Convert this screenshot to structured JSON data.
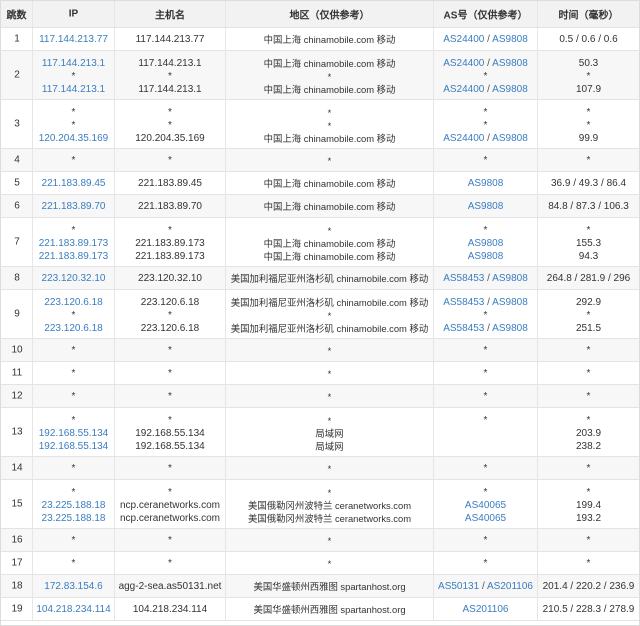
{
  "headers": [
    "跳数",
    "IP",
    "主机名",
    "地区（仅供参考）",
    "AS号（仅供参考）",
    "时间（毫秒）"
  ],
  "hops": [
    {
      "hop": "1",
      "lines": [
        {
          "ip": "117.144.213.77",
          "host": "117.144.213.77",
          "region": "中国上海 chinamobile.com 移动",
          "as": [
            "AS24400",
            "AS9808"
          ],
          "time": "0.5 / 0.6 / 0.6"
        }
      ]
    },
    {
      "hop": "2",
      "lines": [
        {
          "ip": "117.144.213.1",
          "host": "117.144.213.1",
          "region": "中国上海 chinamobile.com 移动",
          "as": [
            "AS24400",
            "AS9808"
          ],
          "time": "50.3"
        },
        {
          "ip": "*",
          "host": "*",
          "region": "*",
          "as": [
            "*"
          ],
          "time": "*"
        },
        {
          "ip": "117.144.213.1",
          "host": "117.144.213.1",
          "region": "中国上海 chinamobile.com 移动",
          "as": [
            "AS24400",
            "AS9808"
          ],
          "time": "107.9"
        }
      ]
    },
    {
      "hop": "3",
      "lines": [
        {
          "ip": "*",
          "host": "*",
          "region": "*",
          "as": [
            "*"
          ],
          "time": "*"
        },
        {
          "ip": "*",
          "host": "*",
          "region": "*",
          "as": [
            "*"
          ],
          "time": "*"
        },
        {
          "ip": "120.204.35.169",
          "host": "120.204.35.169",
          "region": "中国上海 chinamobile.com 移动",
          "as": [
            "AS24400",
            "AS9808"
          ],
          "time": "99.9"
        }
      ]
    },
    {
      "hop": "4",
      "lines": [
        {
          "ip": "*",
          "host": "*",
          "region": "*",
          "as": [
            "*"
          ],
          "time": "*"
        }
      ]
    },
    {
      "hop": "5",
      "lines": [
        {
          "ip": "221.183.89.45",
          "host": "221.183.89.45",
          "region": "中国上海 chinamobile.com 移动",
          "as": [
            "AS9808"
          ],
          "time": "36.9 / 49.3 / 86.4"
        }
      ]
    },
    {
      "hop": "6",
      "lines": [
        {
          "ip": "221.183.89.70",
          "host": "221.183.89.70",
          "region": "中国上海 chinamobile.com 移动",
          "as": [
            "AS9808"
          ],
          "time": "84.8 / 87.3 / 106.3"
        }
      ]
    },
    {
      "hop": "7",
      "lines": [
        {
          "ip": "*",
          "host": "*",
          "region": "*",
          "as": [
            "*"
          ],
          "time": "*"
        },
        {
          "ip": "221.183.89.173",
          "host": "221.183.89.173",
          "region": "中国上海 chinamobile.com 移动",
          "as": [
            "AS9808"
          ],
          "time": "155.3"
        },
        {
          "ip": "221.183.89.173",
          "host": "221.183.89.173",
          "region": "中国上海 chinamobile.com 移动",
          "as": [
            "AS9808"
          ],
          "time": "94.3"
        }
      ]
    },
    {
      "hop": "8",
      "lines": [
        {
          "ip": "223.120.32.10",
          "host": "223.120.32.10",
          "region": "美国加利福尼亚州洛杉矶 chinamobile.com 移动",
          "as": [
            "AS58453",
            "AS9808"
          ],
          "time": "264.8 / 281.9 / 296"
        }
      ]
    },
    {
      "hop": "9",
      "lines": [
        {
          "ip": "223.120.6.18",
          "host": "223.120.6.18",
          "region": "美国加利福尼亚州洛杉矶 chinamobile.com 移动",
          "as": [
            "AS58453",
            "AS9808"
          ],
          "time": "292.9"
        },
        {
          "ip": "*",
          "host": "*",
          "region": "*",
          "as": [
            "*"
          ],
          "time": "*"
        },
        {
          "ip": "223.120.6.18",
          "host": "223.120.6.18",
          "region": "美国加利福尼亚州洛杉矶 chinamobile.com 移动",
          "as": [
            "AS58453",
            "AS9808"
          ],
          "time": "251.5"
        }
      ]
    },
    {
      "hop": "10",
      "lines": [
        {
          "ip": "*",
          "host": "*",
          "region": "*",
          "as": [
            "*"
          ],
          "time": "*"
        }
      ]
    },
    {
      "hop": "11",
      "lines": [
        {
          "ip": "*",
          "host": "*",
          "region": "*",
          "as": [
            "*"
          ],
          "time": "*"
        }
      ]
    },
    {
      "hop": "12",
      "lines": [
        {
          "ip": "*",
          "host": "*",
          "region": "*",
          "as": [
            "*"
          ],
          "time": "*"
        }
      ]
    },
    {
      "hop": "13",
      "lines": [
        {
          "ip": "*",
          "host": "*",
          "region": "*",
          "as": [
            "*"
          ],
          "time": "*"
        },
        {
          "ip": "192.168.55.134",
          "host": "192.168.55.134",
          "region": "局域网",
          "as": [],
          "time": "203.9"
        },
        {
          "ip": "192.168.55.134",
          "host": "192.168.55.134",
          "region": "局域网",
          "as": [],
          "time": "238.2"
        }
      ]
    },
    {
      "hop": "14",
      "lines": [
        {
          "ip": "*",
          "host": "*",
          "region": "*",
          "as": [
            "*"
          ],
          "time": "*"
        }
      ]
    },
    {
      "hop": "15",
      "lines": [
        {
          "ip": "*",
          "host": "*",
          "region": "*",
          "as": [
            "*"
          ],
          "time": "*"
        },
        {
          "ip": "23.225.188.18",
          "host": "ncp.ceranetworks.com",
          "region": "美国俄勒冈州波特兰 ceranetworks.com",
          "as": [
            "AS40065"
          ],
          "time": "199.4"
        },
        {
          "ip": "23.225.188.18",
          "host": "ncp.ceranetworks.com",
          "region": "美国俄勒冈州波特兰 ceranetworks.com",
          "as": [
            "AS40065"
          ],
          "time": "193.2"
        }
      ]
    },
    {
      "hop": "16",
      "lines": [
        {
          "ip": "*",
          "host": "*",
          "region": "*",
          "as": [
            "*"
          ],
          "time": "*"
        }
      ]
    },
    {
      "hop": "17",
      "lines": [
        {
          "ip": "*",
          "host": "*",
          "region": "*",
          "as": [
            "*"
          ],
          "time": "*"
        }
      ]
    },
    {
      "hop": "18",
      "lines": [
        {
          "ip": "172.83.154.6",
          "host": "agg-2-sea.as50131.net",
          "region": "美国华盛顿州西雅图 spartanhost.org",
          "as": [
            "AS50131",
            "AS201106"
          ],
          "time": "201.4 / 220.2 / 236.9"
        }
      ]
    },
    {
      "hop": "19",
      "lines": [
        {
          "ip": "104.218.234.114",
          "host": "104.218.234.114",
          "region": "美国华盛顿州西雅图 spartanhost.org",
          "as": [
            "AS201106"
          ],
          "time": "210.5 / 228.3 / 278.9"
        }
      ]
    }
  ]
}
